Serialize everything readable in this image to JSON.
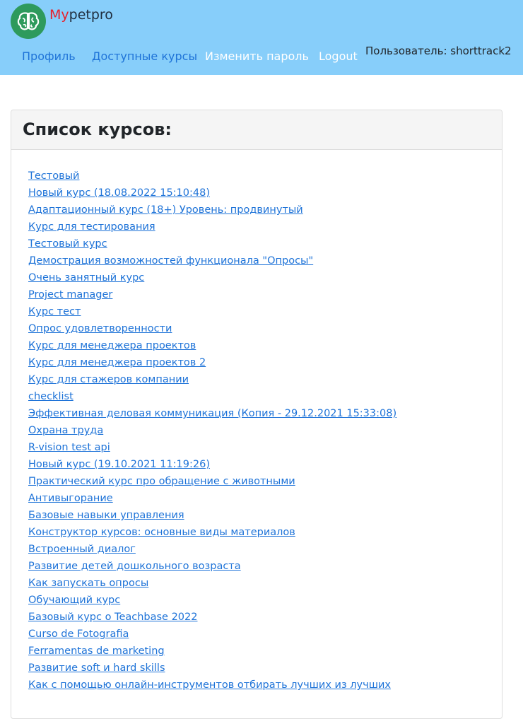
{
  "header": {
    "brand_part1": "My",
    "brand_part2": "petpro",
    "logo_icon": "brain-icon",
    "nav": {
      "profile": "Профиль",
      "courses": "Доступные курсы",
      "change_password": "Изменить пароль",
      "logout": "Logout"
    },
    "user_label": "Пользователь: shorttrack2"
  },
  "main": {
    "title": "Список курсов:",
    "courses": [
      "Тестовый",
      "Новый курс (18.08.2022 15:10:48)",
      "Адаптационный курс (18+) Уровень: продвинутый",
      "Курс для тестирования",
      "Тестовый курс",
      "Демострация возможностей функционала \"Опросы\"",
      "Очень занятный курс",
      "Project manager",
      "Курс тест",
      "Опрос удовлетворенности",
      "Курс для менеджера проектов",
      "Курс для менеджера проектов 2",
      "Курс для стажеров компании",
      "checklist",
      "Эффективная деловая коммуникация (Копия - 29.12.2021 15:33:08)",
      "Охрана труда",
      "R-vision test api",
      "Новый курс (19.10.2021 11:19:26)",
      "Практический курс про обращение с животными",
      "Антивыгорание",
      "Базовые навыки управления",
      "Конструктор курсов: основные виды материалов",
      "Встроенный диалог",
      "Развитие детей дошкольного возраста",
      "Как запускать опросы",
      "Обучающий курс",
      "Базовый курс о Teachbase 2022",
      "Curso de Fotografia",
      "Ferramentas de marketing",
      "Развитие soft и hard skills",
      "Как с помощью онлайн-инструментов отбирать лучших из лучших"
    ]
  },
  "colors": {
    "header_bg": "#87cefa",
    "link": "#1e73d8",
    "brand_accent": "#e8202a",
    "logo_bg": "#2e9a5c"
  }
}
